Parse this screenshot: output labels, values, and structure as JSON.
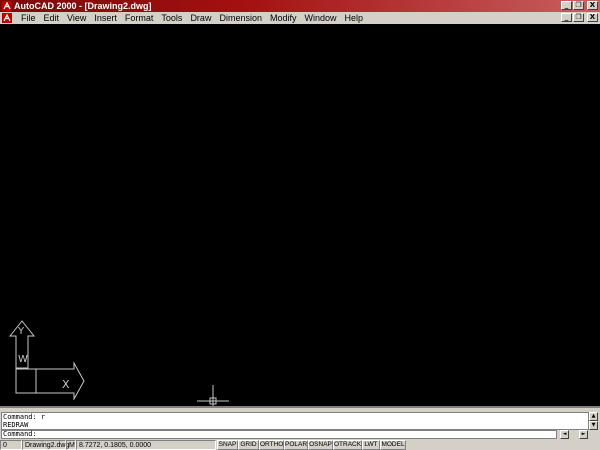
{
  "window": {
    "title": "AutoCAD 2000 - [Drawing2.dwg]",
    "minimize": "_",
    "restore": "❐",
    "close": "X"
  },
  "menu": {
    "items": [
      "File",
      "Edit",
      "View",
      "Insert",
      "Format",
      "Tools",
      "Draw",
      "Dimension",
      "Modify",
      "Window",
      "Help"
    ]
  },
  "ucs": {
    "x_label": "X",
    "y_label": "Y",
    "w_label": "W"
  },
  "command": {
    "history": [
      "Command: r",
      "REDRAW"
    ],
    "prompt": "Command:"
  },
  "status": {
    "layer": "0",
    "file": "Drawing2.dwg",
    "mode": "M",
    "coords": "8.7272, 0.1805, 0.0000",
    "toggles": [
      "SNAP",
      "GRID",
      "ORTHO",
      "POLAR",
      "OSNAP",
      "OTRACK",
      "LWT",
      "MODEL"
    ]
  },
  "colors": {
    "titlebar": "#a31010",
    "canvas": "#000000",
    "chrome": "#d4d0c8",
    "ucs": "#c8c8c8"
  }
}
